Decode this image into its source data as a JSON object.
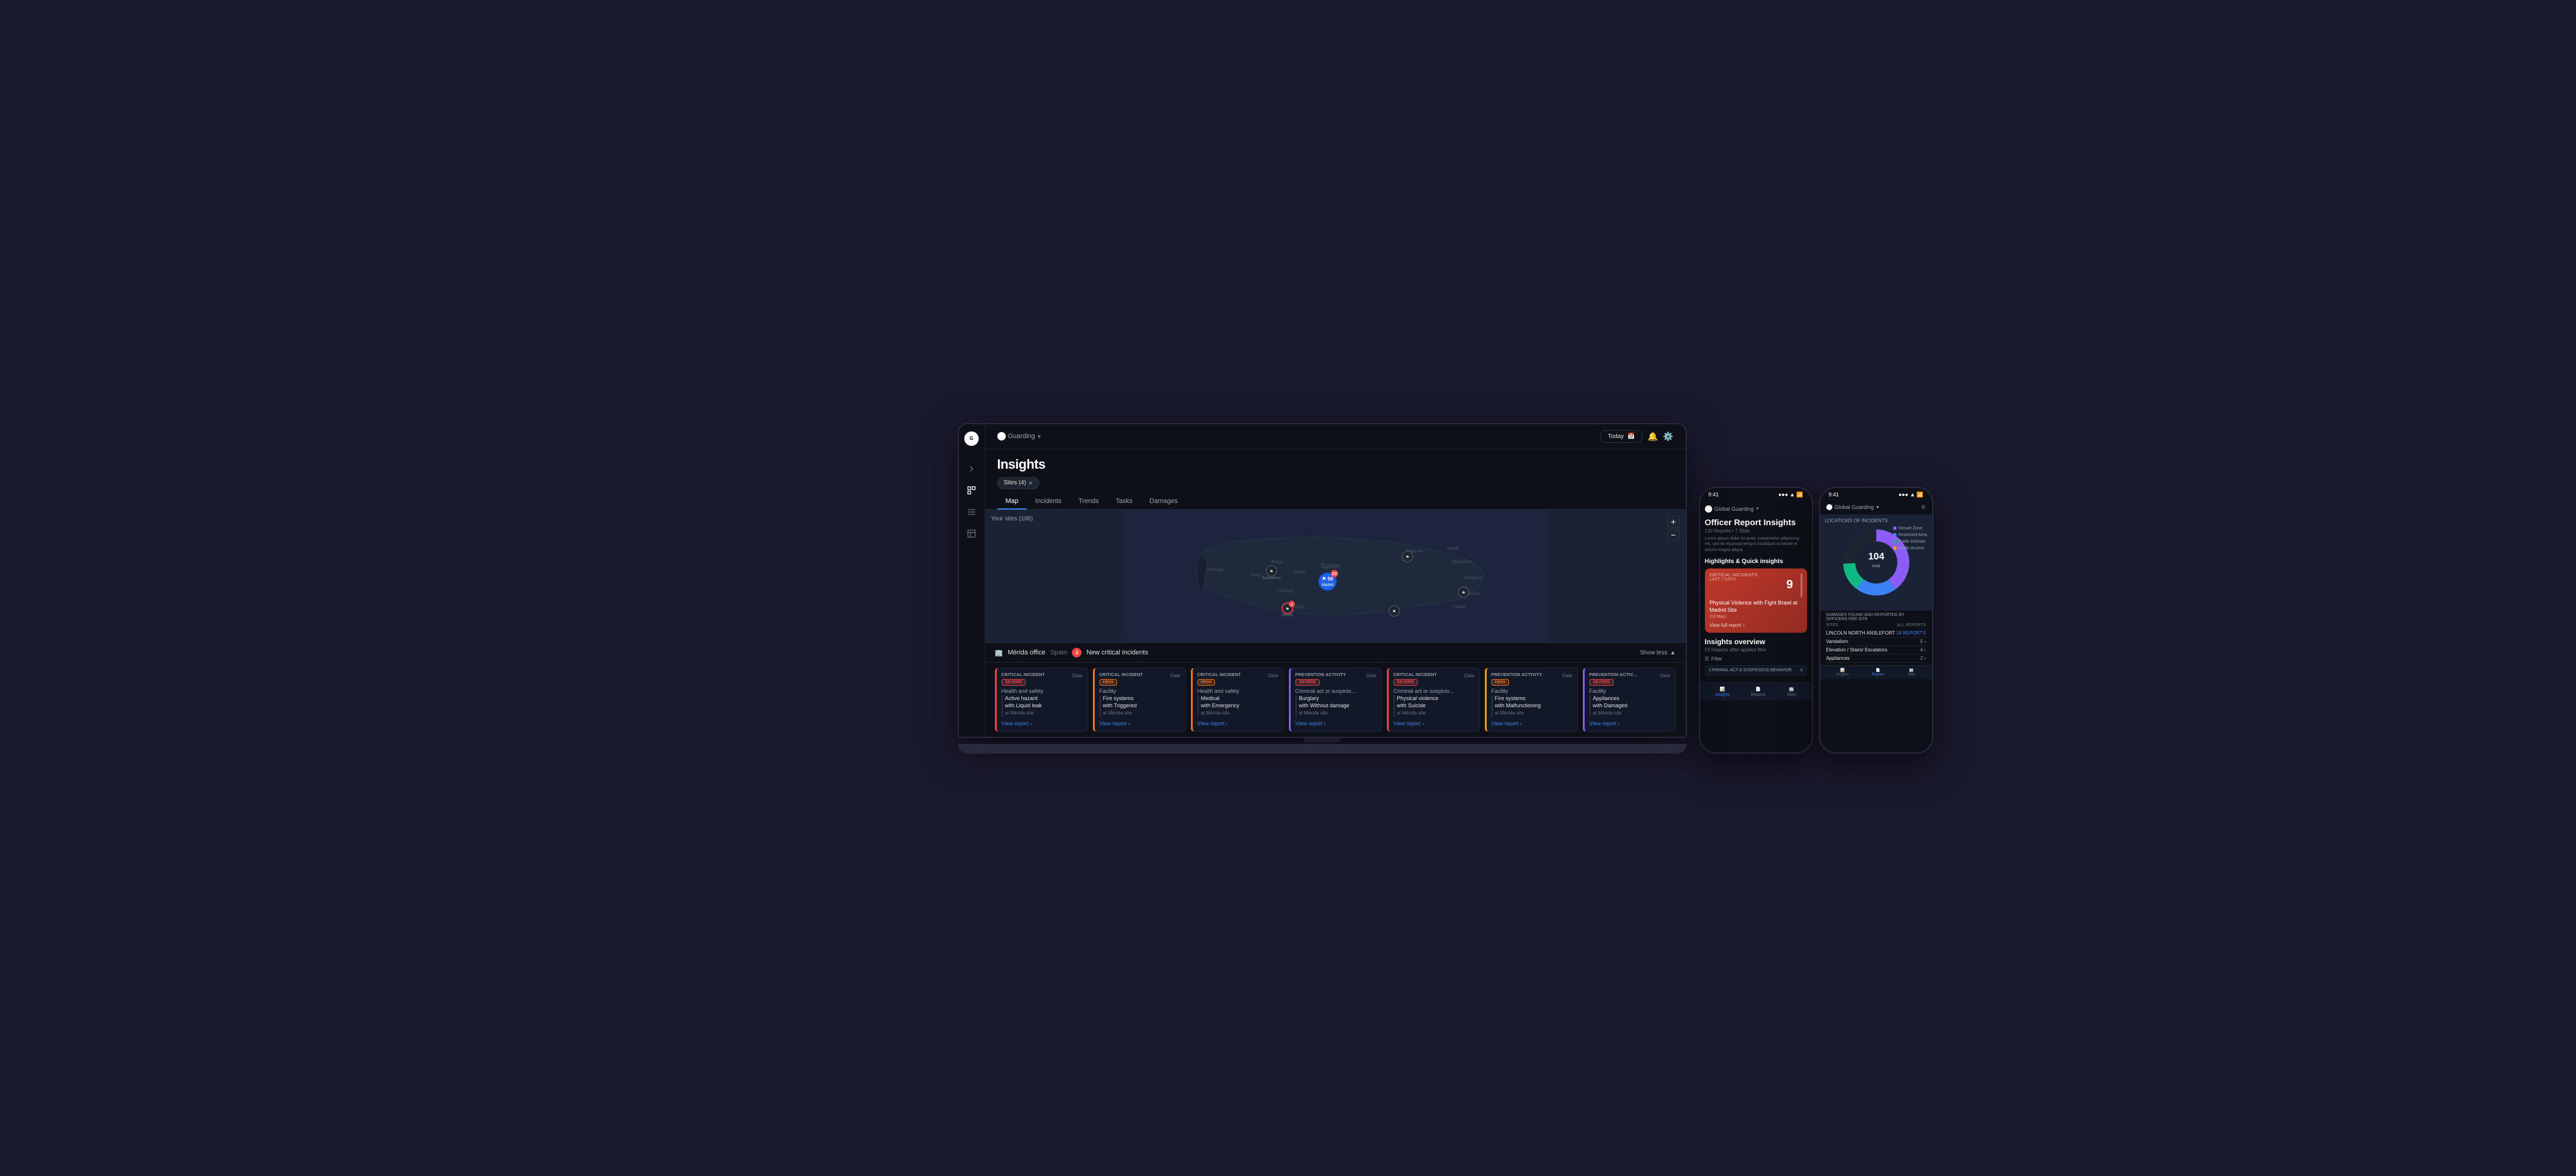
{
  "header": {
    "brand": "Guarding",
    "title": "Insights",
    "bell_icon": "🔔",
    "filter_icon": "⚙",
    "date": "Today",
    "sites_filter": "Sites (4)"
  },
  "tabs": [
    {
      "label": "Map",
      "active": true
    },
    {
      "label": "Incidents",
      "active": false
    },
    {
      "label": "Trends",
      "active": false
    },
    {
      "label": "Tasks",
      "active": false
    },
    {
      "label": "Damages",
      "active": false
    }
  ],
  "map": {
    "site_count": "Your sites (186)",
    "zoom_in": "+",
    "zoom_out": "−"
  },
  "incidents_section": {
    "location": "Mérida office",
    "country": "Spain",
    "critical_count": "3",
    "critical_label": "New critical incidents",
    "show_less": "Show less"
  },
  "cards": [
    {
      "type": "CRITICAL INCIDENT",
      "severity": "SEVERE",
      "severity_class": "severe",
      "date": "Date",
      "category": "Health and safety",
      "title": "Active hazard",
      "detail": "with Liquid leak",
      "location": "at Mérida site",
      "view_report": "View report",
      "card_class": "critical-severe"
    },
    {
      "type": "CRITICAL INCIDENT",
      "severity": "HIGH",
      "severity_class": "high",
      "date": "Date",
      "category": "Facility",
      "title": "Fire systems",
      "detail": "with Triggered",
      "location": "at Mérida site",
      "view_report": "View report",
      "card_class": "critical-high"
    },
    {
      "type": "CRITICAL INCIDENT",
      "severity": "HIGH",
      "severity_class": "high",
      "date": "Date",
      "category": "Health and safety",
      "title": "Medical",
      "detail": "with Emergency",
      "location": "at Mérida site",
      "view_report": "View report",
      "card_class": "critical-high"
    },
    {
      "type": "PREVENTION ACTIVITY",
      "severity": "SEVERE",
      "severity_class": "severe",
      "date": "Date",
      "category": "Criminal act or suspicio...",
      "title": "Burglary",
      "detail": "with Without damage",
      "location": "at Mérida site",
      "view_report": "View report",
      "card_class": "prevention-severe"
    },
    {
      "type": "CRITICAL INCIDENT",
      "severity": "SEVERE",
      "severity_class": "severe",
      "date": "Date",
      "category": "Criminal act or suspicio...",
      "title": "Physical violence",
      "detail": "with Suicide",
      "location": "at Mérida site",
      "view_report": "View report",
      "card_class": "critical-severe"
    },
    {
      "type": "PREVENTION ACTIVITY",
      "severity": "HIGH",
      "severity_class": "high",
      "date": "Date",
      "category": "Facility",
      "title": "Fire systems",
      "detail": "with Malfunctioning",
      "location": "at Mérida site",
      "view_report": "View report",
      "card_class": "prevention-high"
    },
    {
      "type": "PREVENTION ACTIV...",
      "severity": "SEVERE",
      "severity_class": "severe",
      "date": "Date",
      "category": "Facility",
      "title": "Appliances",
      "detail": "with Damaged",
      "location": "at Mérida site",
      "view_report": "View report",
      "card_class": "prevention-severe"
    }
  ],
  "phone1": {
    "time": "9:41",
    "brand": "Global Guarding",
    "title": "Officer Report Insights",
    "subtitle": "130 Reports • 7 Sites",
    "description": "Lorem ipsum dolor sit amet, consectetur adipiscing elit, sed do eiusmod tempor incididunt ut labore et dolore magna aliqua.",
    "highlights_title": "Highlights & Quick insights",
    "critical_label": "CRITICAL INCIDENTS",
    "critical_period": "LAST 7 DAYS",
    "critical_count": "9",
    "critical_incident_title": "Physical Violence with Fight Brawl at Madrid Site",
    "critical_incident_date": "(13 May)",
    "view_full_report": "View full report",
    "overview_title": "Insights overview",
    "overview_sub": "53 Reports after applied filter",
    "filter_label": "Filter",
    "behavior_label": "CRIMINAL ACT & SUSPICIOUS BEHAVIOR",
    "nav_items": [
      "Insights",
      "Reports",
      "Sites"
    ]
  },
  "phone2": {
    "time": "9:41",
    "brand": "Global Guarding",
    "title": "LOCATIONS OF INCIDENTS",
    "donut_value": "104",
    "legend": [
      {
        "label": "Secure Zone",
        "color": "#8b5cf6"
      },
      {
        "label": "Restricted Area",
        "color": "#3b82f6"
      },
      {
        "label": "Public Domain",
        "color": "#10b981"
      },
      {
        "label": "Public Access",
        "color": "#f59e0b"
      }
    ],
    "damages_title": "DAMAGES FOUND AND REPORTED BY OFFICERS PER SITE",
    "sites_label": "SITES",
    "all_reports": "ALL REPORTS",
    "damages": [
      {
        "site": "LINCOLN NORTH ANSLEFORT",
        "count": "18 REPORTS"
      },
      {
        "site": "Vandalism",
        "count": "5 >"
      },
      {
        "site": "Elevation / Stairs/ Escalators",
        "count": "4 >"
      },
      {
        "site": "Appliances",
        "count": "2 >"
      }
    ],
    "nav_items": [
      "Insights",
      "Reports",
      "Sites"
    ]
  },
  "sidebar": {
    "items": [
      {
        "name": "expand",
        "icon": "»"
      },
      {
        "name": "chart",
        "icon": "▦"
      },
      {
        "name": "list",
        "icon": "≡"
      },
      {
        "name": "building",
        "icon": "⊞"
      }
    ]
  }
}
